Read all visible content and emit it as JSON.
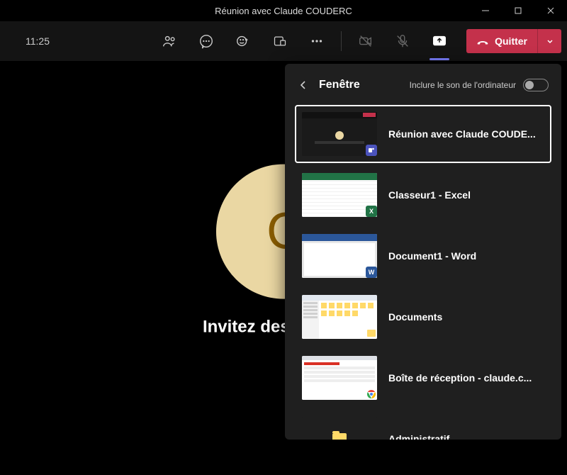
{
  "window": {
    "title": "Réunion avec Claude COUDERC"
  },
  "toolbar": {
    "time": "11:25",
    "leave_label": "Quitter"
  },
  "main": {
    "invite_text": "Invitez des contacts",
    "avatar_initials": "CC"
  },
  "share_panel": {
    "title": "Fenêtre",
    "sound_label": "Inclure le son de l'ordinateur",
    "sound_enabled": false,
    "items": [
      {
        "label": "Réunion avec Claude COUDE...",
        "selected": true,
        "kind": "teams"
      },
      {
        "label": "Classeur1 - Excel",
        "selected": false,
        "kind": "excel"
      },
      {
        "label": "Document1 - Word",
        "selected": false,
        "kind": "word"
      },
      {
        "label": "Documents",
        "selected": false,
        "kind": "explorer"
      },
      {
        "label": "Boîte de réception - claude.c...",
        "selected": false,
        "kind": "chrome"
      },
      {
        "label": "Administratif",
        "selected": false,
        "kind": "folder"
      }
    ]
  }
}
